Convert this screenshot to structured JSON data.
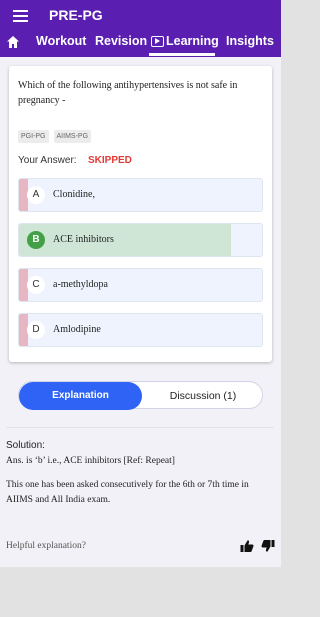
{
  "app": {
    "title": "PRE-PG"
  },
  "tabs": {
    "workout": "Workout",
    "revision": "Revision",
    "learning": "Learning",
    "insights": "Insights"
  },
  "question": {
    "text": "Which of the following antihypertensives is not safe in pregnancy -",
    "tags": [
      "PGI-PG",
      "AIIMS-PG"
    ],
    "your_answer_label": "Your Answer:",
    "your_answer_value": "SKIPPED",
    "options": [
      {
        "letter": "A",
        "text": "Clonidine,"
      },
      {
        "letter": "B",
        "text": "ACE inhibitors"
      },
      {
        "letter": "C",
        "text": "a-methyldopa"
      },
      {
        "letter": "D",
        "text": "Amlodipine"
      }
    ]
  },
  "segments": {
    "explanation": "Explanation",
    "discussion": "Discussion (1)"
  },
  "solution": {
    "title": "Solution:",
    "line1": "Ans. is ‘b’ i.e., ACE inhibitors [Ref: Repeat]",
    "line2": "This one has been asked consecutively for the 6th or 7th time in AIIMS and All India exam."
  },
  "feedback": {
    "prompt": "Helpful explanation?"
  },
  "colors": {
    "appbar": "#5a1fb0",
    "accent": "#2f63f5",
    "skipped": "#e53935",
    "correct": "#43a047"
  }
}
